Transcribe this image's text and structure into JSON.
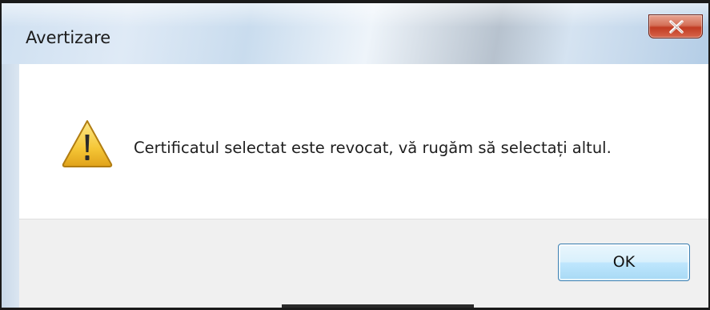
{
  "window": {
    "title": "Avertizare",
    "close_symbol": "X"
  },
  "dialog": {
    "icon": "warning-icon",
    "message": "Certificatul selectat este revocat, vă rugăm să selectați altul."
  },
  "buttons": {
    "ok_label": "OK"
  },
  "colors": {
    "close_button": "#c94f35",
    "ok_button_border": "#3c7fb1",
    "warning_fill": "#f5c636"
  }
}
